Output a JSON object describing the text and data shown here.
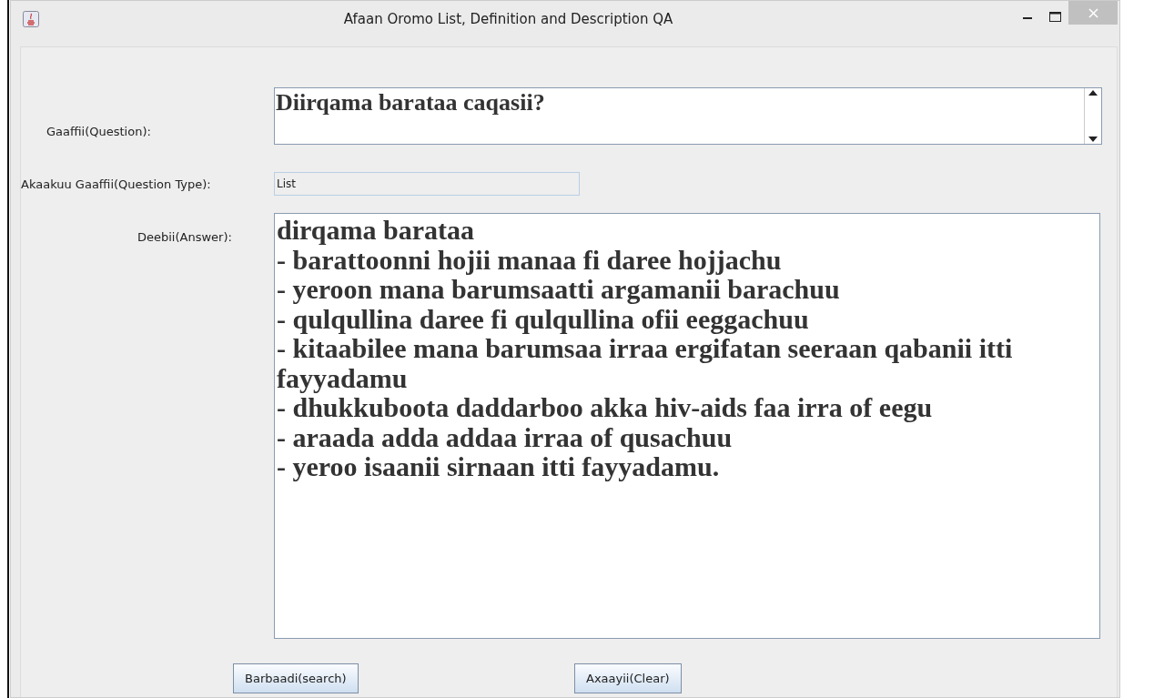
{
  "window": {
    "title": "Afaan Oromo List, Definition and Description QA"
  },
  "question": {
    "label": "Gaaffii(Question):",
    "value": "Diirqama barataa caqasii?"
  },
  "question_type": {
    "label": "Akaakuu Gaaffii(Question Type):",
    "value": "List"
  },
  "answer": {
    "label": "Deebii(Answer):",
    "value": "dirqama barataa\n- barattoonni hojii manaa fi daree hojjachu\n- yeroon mana barumsaatti argamanii barachuu\n- qulqullina daree fi qulqullina ofii eeggachuu\n- kitaabilee mana barumsaa irraa ergifatan seeraan qabanii itti fayyadamu\n- dhukkuboota daddarboo akka hiv-aids faa irra of eegu\n- araada adda addaa irraa of qusachuu\n- yeroo isaanii sirnaan itti fayyadamu."
  },
  "buttons": [
    {
      "label": "Barbaadi(search)",
      "kind": "search"
    },
    {
      "label": "Axaayii(Clear)",
      "kind": "clear"
    }
  ]
}
